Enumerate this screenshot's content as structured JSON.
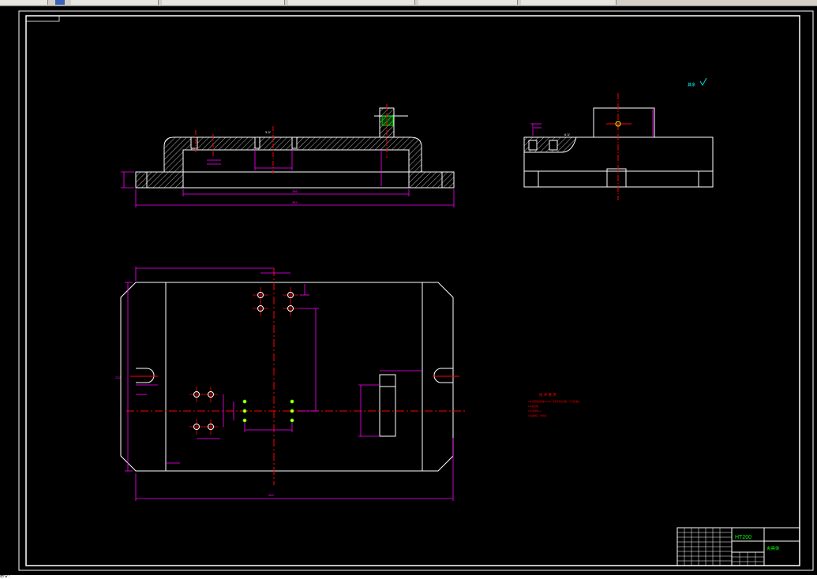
{
  "window": {
    "command_line_text": "命令:"
  },
  "drawing": {
    "surface_finish_note": "其余",
    "tech_requirements_title": "技 术 要 求",
    "tech_requirements_lines": [
      "1.未注明铸造圆角R3~R5，铸件不得有砂眼、气孔等缺陷。",
      "2.时效处理。",
      "3.未注倒角C1。",
      "4.锐边倒钝，去毛刺。"
    ],
    "material": "HT200",
    "part_name": "夹具体",
    "colors": {
      "background": "#000000",
      "outline": "#ffffff",
      "dimension": "#ff00ff",
      "centerline": "#ff0000",
      "hatch": "#ffffff",
      "note_green": "#00ff00",
      "note_cyan": "#00ffff",
      "hole_marker": "#ffff00"
    }
  }
}
